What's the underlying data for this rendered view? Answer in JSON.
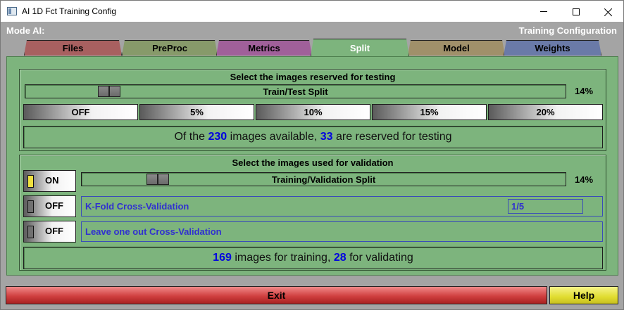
{
  "window": {
    "title": "AI 1D Fct Training Config",
    "icon": "app-window-icon",
    "controls": [
      "minimize-icon",
      "maximize-icon",
      "close-icon"
    ]
  },
  "header": {
    "mode_label": "Mode AI:",
    "config_label": "Training Configuration"
  },
  "tabs": [
    {
      "label": "Files",
      "color": "#a86060"
    },
    {
      "label": "PreProc",
      "color": "#879a6a"
    },
    {
      "label": "Metrics",
      "color": "#a0609a"
    },
    {
      "label": "Split",
      "color": "#7db47d",
      "active": true
    },
    {
      "label": "Model",
      "color": "#a0906a"
    },
    {
      "label": "Weights",
      "color": "#6a7aa8"
    }
  ],
  "testing": {
    "title": "Select the images reserved for testing",
    "slider_label": "Train/Test Split",
    "slider_value": 14,
    "percent": "14%",
    "presets": [
      "OFF",
      "5%",
      "10%",
      "15%",
      "20%"
    ],
    "info": {
      "prefix": "Of the",
      "available": "230",
      "middle": "images available,",
      "reserved": "33",
      "suffix": "are reserved for testing"
    }
  },
  "validation": {
    "title": "Select the images used for validation",
    "toggle_label": "ON",
    "toggle_on": true,
    "slider_label": "Training/Validation Split",
    "slider_value": 14,
    "percent": "14%",
    "kfold": {
      "toggle_label": "OFF",
      "label": "K-Fold Cross-Validation",
      "value": "1/5"
    },
    "loo": {
      "toggle_label": "OFF",
      "label": "Leave one out Cross-Validation"
    },
    "info": {
      "training": "169",
      "middle": "images for training,",
      "validating": "28",
      "suffix": "for validating"
    }
  },
  "footer": {
    "exit_label": "Exit",
    "help_label": "Help"
  },
  "colors": {
    "panel": "#7db47d",
    "accent_number": "#0000e0",
    "cv_text": "#3030d0",
    "exit": "#d04040",
    "help": "#e0dc30"
  }
}
